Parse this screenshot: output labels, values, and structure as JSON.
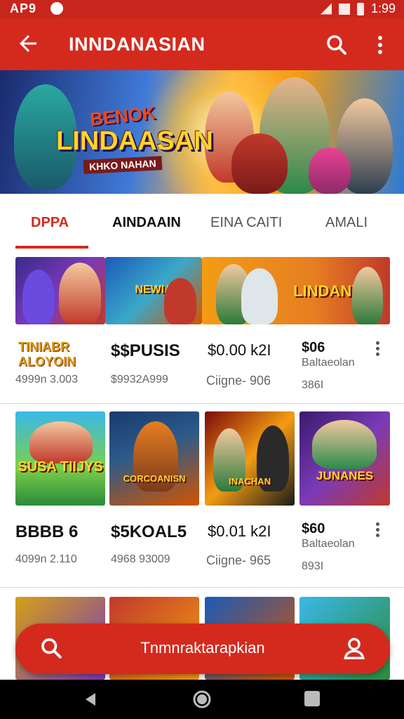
{
  "status_bar": {
    "left_text": "AP9",
    "time": "1:99"
  },
  "app_bar": {
    "title": "INNDANASIAN",
    "back_icon": "arrow-left-icon",
    "search_icon": "search-icon",
    "more_icon": "more-vert-icon"
  },
  "banner": {
    "line1": "BENOK",
    "line2": "LINDAASAN",
    "line3": "KHKO NAHAN"
  },
  "tabs": [
    {
      "label": "DPPA",
      "active": true
    },
    {
      "label": "AINDAAIN",
      "active": false
    },
    {
      "label": "EINA CAITI",
      "active": false
    },
    {
      "label": "AMALI",
      "active": false
    }
  ],
  "row1": {
    "thumb_labels": [
      "",
      "NEWIA",
      "LINDANY"
    ],
    "items": [
      {
        "title": "TINIABR ALOYOIN",
        "sub": "4999n 3.003"
      },
      {
        "title": "$$PUSIS",
        "sub": "$9932A999"
      },
      {
        "title": "$0.00 k2I",
        "sub": "Ciigne- 906"
      },
      {
        "title": "$06",
        "sub": "Baltaeolan",
        "sub2": "386I"
      }
    ]
  },
  "row2": {
    "thumb_labels": [
      "SUSA TIIJYS",
      "CORCOANISN",
      "INACHAN",
      "JUNANES"
    ],
    "items": [
      {
        "title": "BBBB 6",
        "sub": "4099n 2.110"
      },
      {
        "title": "$5KOAL5",
        "sub": "4968 93009"
      },
      {
        "title": "$0.01 k2I",
        "sub": "Ciigne- 965"
      },
      {
        "title": "$60",
        "sub": "Baltaeolan",
        "sub2": "893I"
      }
    ]
  },
  "cta": {
    "label": "Tnmnraktarapkian"
  },
  "colors": {
    "brand_red": "#d42a1e",
    "status_red": "#c8261c"
  }
}
